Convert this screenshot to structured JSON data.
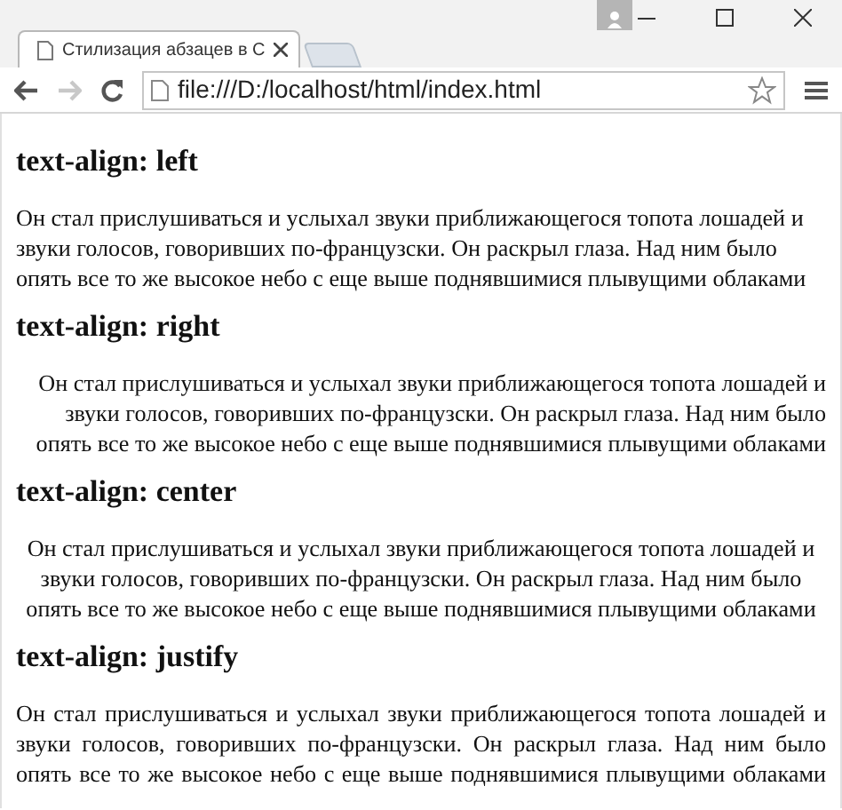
{
  "window": {
    "tab": {
      "title": "Стилизация абзацев в С",
      "selected": true
    },
    "back_enabled": true,
    "forward_enabled": false,
    "address": "file:///D:/localhost/html/index.html"
  },
  "sections": [
    {
      "heading": "text-align: left",
      "kind": "left",
      "text": "Он стал прислушиваться и услыхал звуки приближающегося топота лошадей и звуки голосов, говоривших по-французски. Он раскрыл глаза. Над ним было опять все то же высокое небо с еще выше поднявшимися плывущими облаками"
    },
    {
      "heading": "text-align: right",
      "kind": "right",
      "text": "Он стал прислушиваться и услыхал звуки приближающегося топота лошадей и звуки голосов, говоривших по-французски. Он раскрыл глаза. Над ним было опять все то же высокое небо с еще выше поднявшимися плывущими облаками"
    },
    {
      "heading": "text-align: center",
      "kind": "center",
      "text": "Он стал прислушиваться и услыхал звуки приближающегося топота лошадей и звуки голосов, говоривших по-французски. Он раскрыл глаза. Над ним было опять все то же высокое небо с еще выше поднявшимися плывущими облаками"
    },
    {
      "heading": "text-align: justify",
      "kind": "justify",
      "text": "Он стал прислушиваться и услыхал звуки приближающегося топота лошадей и звуки голосов, говоривших по-французски. Он раскрыл глаза. Над ним было опять все то же высокое небо с еще выше поднявшимися плывущими облаками"
    }
  ]
}
